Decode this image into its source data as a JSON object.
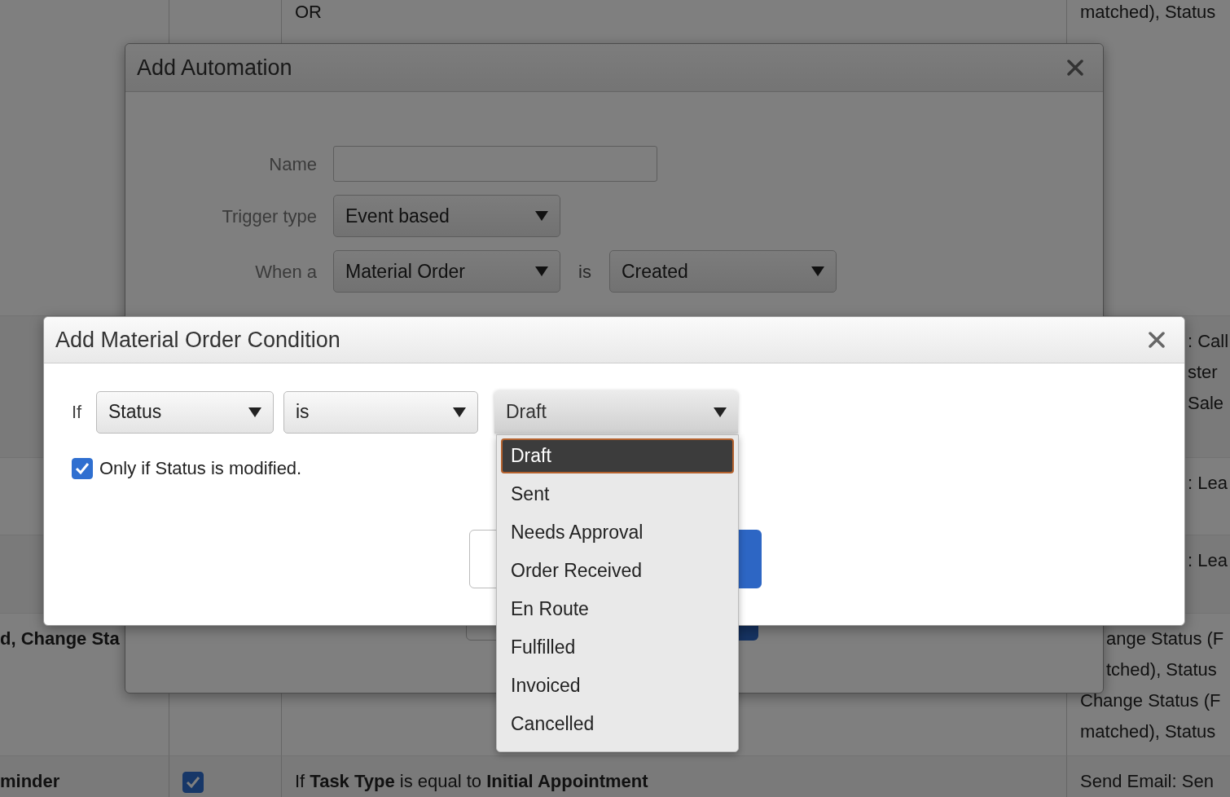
{
  "background_table": {
    "rows": [
      {
        "column_3": [
          "OR"
        ],
        "column_4": [
          "matched), Status"
        ]
      },
      {
        "column_4": [
          ": Call",
          "ster",
          "Sale"
        ]
      },
      {
        "column_4": [
          ": Lea"
        ]
      },
      {
        "column_4": [
          ": Lea"
        ]
      },
      {
        "column_1": "d, Change Sta",
        "column_4": [
          "ange Status (F",
          "tched), Status",
          "Change Status (F",
          "matched), Status"
        ]
      },
      {
        "column_1": "minder",
        "checkbox": {
          "checked": true
        },
        "column_3": [
          "If **Task Type** is equal to **Initial Appointment**"
        ],
        "column_4": [
          "Send Email: Sen"
        ]
      }
    ]
  },
  "automation_modal": {
    "title": "Add Automation",
    "fields": [
      {
        "label": "Name",
        "kind": "text"
      },
      {
        "label": "Trigger type",
        "kind": "select",
        "values": [
          "Event based"
        ]
      },
      {
        "label": "When a",
        "kind": "select",
        "values": [
          "Material Order",
          "Created"
        ],
        "joiner": "is"
      }
    ]
  },
  "condition_modal": {
    "title": "Add Material Order Condition",
    "if_label": "If",
    "field_select": "Status",
    "operator_select": "is",
    "value_select": {
      "value": "Draft",
      "expanded": true,
      "options": [
        {
          "label": "Draft",
          "selected": true
        },
        {
          "label": "Sent",
          "selected": false
        },
        {
          "label": "Needs Approval",
          "selected": false
        },
        {
          "label": "Order Received",
          "selected": false
        },
        {
          "label": "En Route",
          "selected": false
        },
        {
          "label": "Fulfilled",
          "selected": false
        },
        {
          "label": "Invoiced",
          "selected": false
        },
        {
          "label": "Cancelled",
          "selected": false
        }
      ]
    },
    "only_if_modified": {
      "label": "Only if Status is modified.",
      "checked": true
    }
  }
}
